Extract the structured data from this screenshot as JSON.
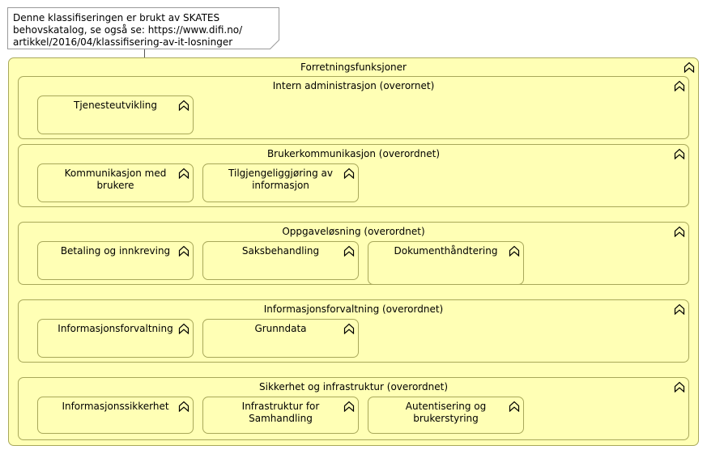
{
  "note": {
    "lines": [
      "Denne klassifiseringen er brukt av SKATES",
      "behovskatalog, se også se: https://www.difi.no/",
      "artikkel/2016/04/klassifisering-av-it-losninger"
    ]
  },
  "root": {
    "title": "Forretningsfunksjoner",
    "icon": "function-icon"
  },
  "groups": [
    {
      "title": "Intern administrasjon (overornet)",
      "items": [
        {
          "lines": [
            "Tjenesteutvikling"
          ]
        }
      ]
    },
    {
      "title": "Brukerkommunikasjon (overordnet)",
      "items": [
        {
          "lines": [
            "Kommunikasjon med",
            "brukere"
          ]
        },
        {
          "lines": [
            "Tilgjengeliggjøring av",
            "informasjon"
          ]
        }
      ]
    },
    {
      "title": "Oppgaveløsning (overordnet)",
      "items": [
        {
          "lines": [
            "Betaling og innkreving"
          ]
        },
        {
          "lines": [
            "Saksbehandling"
          ]
        },
        {
          "lines": [
            "Dokumenthåndtering"
          ]
        }
      ]
    },
    {
      "title": "Informasjonsforvaltning (overordnet)",
      "items": [
        {
          "lines": [
            "Informasjonsforvaltning"
          ]
        },
        {
          "lines": [
            "Grunndata"
          ]
        }
      ]
    },
    {
      "title": "Sikkerhet og infrastruktur (overordnet)",
      "items": [
        {
          "lines": [
            "Informasjonssikkerhet"
          ]
        },
        {
          "lines": [
            "Infrastruktur for",
            "Samhandling"
          ]
        },
        {
          "lines": [
            "Autentisering og",
            "brukerstyring"
          ]
        }
      ]
    }
  ]
}
